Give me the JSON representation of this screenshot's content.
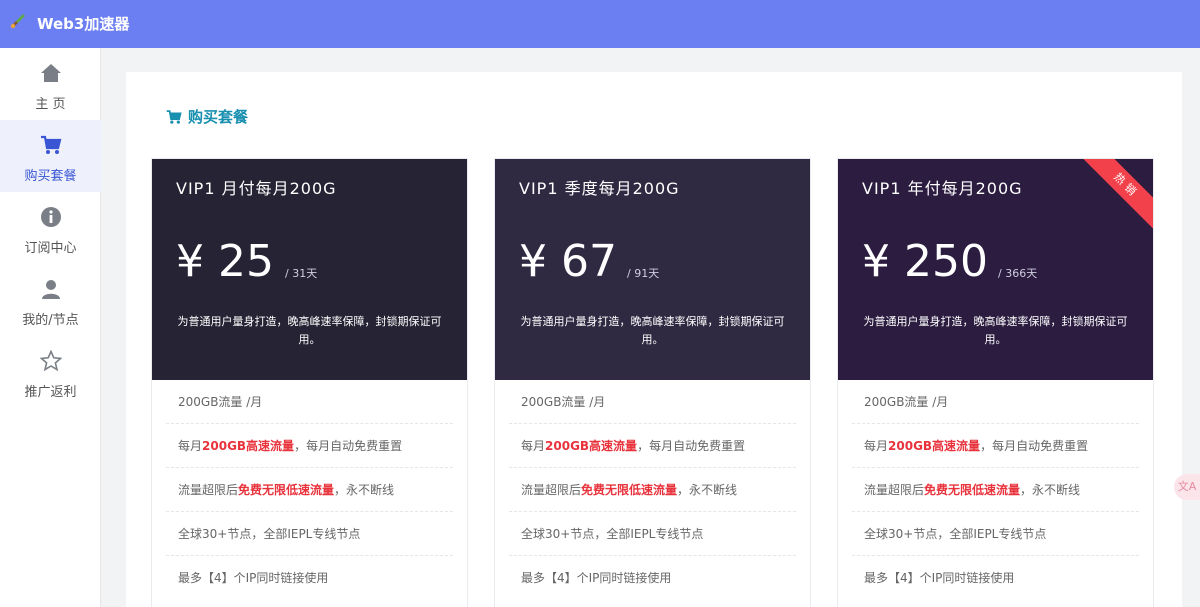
{
  "app": {
    "brand": "Web3加速器",
    "logo_icon": "rocket-icon"
  },
  "colors": {
    "topbar": "#6c7ff2",
    "card1": "#262334",
    "card2": "#2f2a42",
    "card3": "#2b1c40",
    "highlight": "#e8323c",
    "section": "#1990b0"
  },
  "sidebar": {
    "items": [
      {
        "label": "主 页",
        "icon": "home-icon",
        "active": false
      },
      {
        "label": "购买套餐",
        "icon": "cart-icon",
        "active": true
      },
      {
        "label": "订阅中心",
        "icon": "info-icon",
        "active": false
      },
      {
        "label": "我的/节点",
        "icon": "user-icon",
        "active": false
      },
      {
        "label": "推广返利",
        "icon": "star-icon",
        "active": false
      }
    ]
  },
  "section": {
    "title": "购买套餐"
  },
  "plans": [
    {
      "title": "VIP1 月付每月200G",
      "currency": "¥",
      "price": "25",
      "period": "/ 31天",
      "desc": "为普通用户量身打造，晚高峰速率保障，封锁期保证可用。",
      "ribbon": "",
      "features": [
        {
          "pre": "200GB流量 /月",
          "hl": "",
          "post": ""
        },
        {
          "pre": "每月",
          "hl": "200GB高速流量",
          "post": "，每月自动免费重置"
        },
        {
          "pre": "流量超限后",
          "hl": "免费无限低速流量",
          "post": "，永不断线"
        },
        {
          "pre": "全球30+节点，全部IEPL专线节点",
          "hl": "",
          "post": ""
        },
        {
          "pre": "最多【4】个IP同时链接使用",
          "hl": "",
          "post": ""
        }
      ]
    },
    {
      "title": "VIP1 季度每月200G",
      "currency": "¥",
      "price": "67",
      "period": "/ 91天",
      "desc": "为普通用户量身打造，晚高峰速率保障，封锁期保证可用。",
      "ribbon": "",
      "features": [
        {
          "pre": "200GB流量 /月",
          "hl": "",
          "post": ""
        },
        {
          "pre": "每月",
          "hl": "200GB高速流量",
          "post": "，每月自动免费重置"
        },
        {
          "pre": "流量超限后",
          "hl": "免费无限低速流量",
          "post": "，永不断线"
        },
        {
          "pre": "全球30+节点，全部IEPL专线节点",
          "hl": "",
          "post": ""
        },
        {
          "pre": "最多【4】个IP同时链接使用",
          "hl": "",
          "post": ""
        }
      ]
    },
    {
      "title": "VIP1 年付每月200G",
      "currency": "¥",
      "price": "250",
      "period": "/ 366天",
      "desc": "为普通用户量身打造，晚高峰速率保障，封锁期保证可用。",
      "ribbon": "热销",
      "features": [
        {
          "pre": "200GB流量 /月",
          "hl": "",
          "post": ""
        },
        {
          "pre": "每月",
          "hl": "200GB高速流量",
          "post": "，每月自动免费重置"
        },
        {
          "pre": "流量超限后",
          "hl": "免费无限低速流量",
          "post": "，永不断线"
        },
        {
          "pre": "全球30+节点，全部IEPL专线节点",
          "hl": "",
          "post": ""
        },
        {
          "pre": "最多【4】个IP同时链接使用",
          "hl": "",
          "post": ""
        }
      ]
    }
  ],
  "float_badge": {
    "label": "文A"
  }
}
